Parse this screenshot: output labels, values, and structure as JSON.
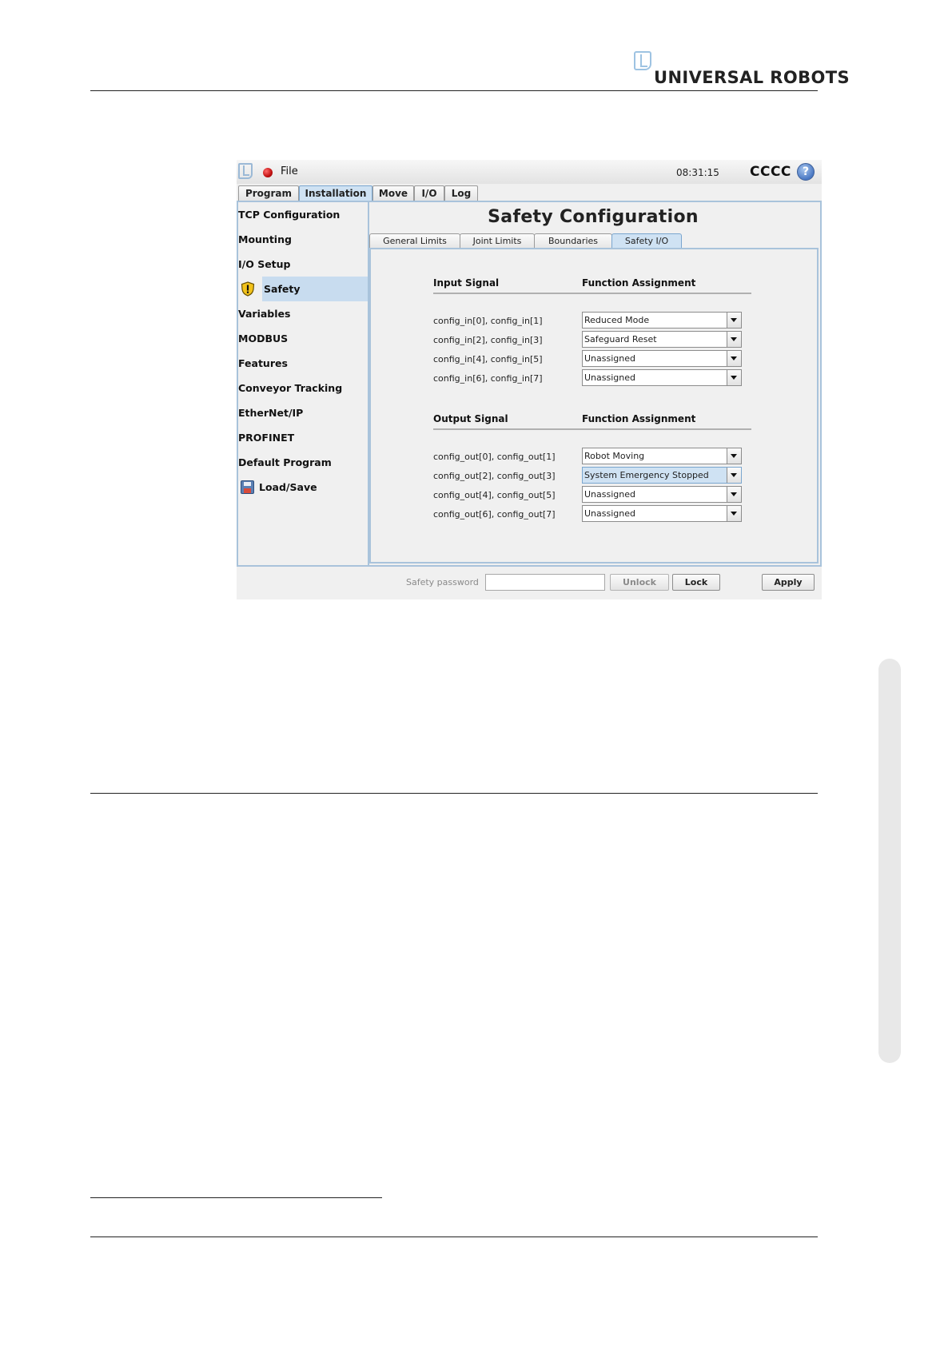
{
  "page": {
    "brand": "UNIVERSAL ROBOTS"
  },
  "titlebar": {
    "menu_label": "File",
    "clock": "08:31:15",
    "robot_name": "CCCC",
    "help_glyph": "?"
  },
  "main_tabs": [
    {
      "label": "Program",
      "active": false
    },
    {
      "label": "Installation",
      "active": true
    },
    {
      "label": "Move",
      "active": false
    },
    {
      "label": "I/O",
      "active": false
    },
    {
      "label": "Log",
      "active": false
    }
  ],
  "sidebar": {
    "items": [
      {
        "label": "TCP Configuration"
      },
      {
        "label": "Mounting"
      },
      {
        "label": "I/O Setup"
      },
      {
        "label": "Safety",
        "icon": "warning-shield-icon",
        "selected": true
      },
      {
        "label": "Variables"
      },
      {
        "label": "MODBUS"
      },
      {
        "label": "Features"
      },
      {
        "label": "Conveyor Tracking"
      },
      {
        "label": "EtherNet/IP"
      },
      {
        "label": "PROFINET"
      },
      {
        "label": "Default Program"
      },
      {
        "label": "Load/Save",
        "icon": "floppy-disk-icon"
      }
    ]
  },
  "safety": {
    "title": "Safety Configuration",
    "tabs": [
      {
        "label": "General Limits",
        "active": false
      },
      {
        "label": "Joint Limits",
        "active": false
      },
      {
        "label": "Boundaries",
        "active": false
      },
      {
        "label": "Safety I/O",
        "active": true
      }
    ],
    "inputs": {
      "header_signal": "Input Signal",
      "header_function": "Function Assignment",
      "rows": [
        {
          "signal": "config_in[0], config_in[1]",
          "value": "Reduced Mode"
        },
        {
          "signal": "config_in[2], config_in[3]",
          "value": "Safeguard Reset"
        },
        {
          "signal": "config_in[4], config_in[5]",
          "value": "Unassigned"
        },
        {
          "signal": "config_in[6], config_in[7]",
          "value": "Unassigned"
        }
      ]
    },
    "outputs": {
      "header_signal": "Output Signal",
      "header_function": "Function Assignment",
      "rows": [
        {
          "signal": "config_out[0], config_out[1]",
          "value": "Robot Moving"
        },
        {
          "signal": "config_out[2], config_out[3]",
          "value": "System Emergency Stopped",
          "selected": true
        },
        {
          "signal": "config_out[4], config_out[5]",
          "value": "Unassigned"
        },
        {
          "signal": "config_out[6], config_out[7]",
          "value": "Unassigned"
        }
      ]
    }
  },
  "footer": {
    "password_label": "Safety password",
    "password_value": "",
    "unlock_label": "Unlock",
    "lock_label": "Lock",
    "apply_label": "Apply"
  },
  "colors": {
    "accent_selected": "#c8dcef",
    "panel_border": "#a9c3db",
    "background": "#f0f0f0"
  }
}
